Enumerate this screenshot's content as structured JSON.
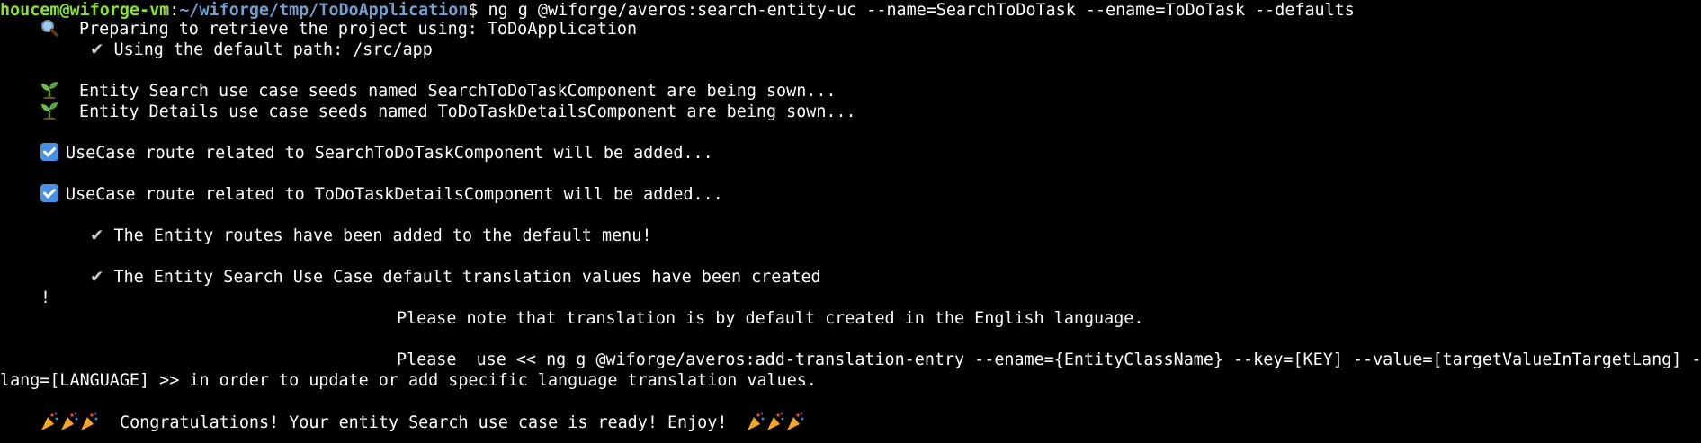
{
  "terminal": {
    "prompt": {
      "user_host": "houcem@wiforge-vm",
      "separator": ":",
      "path": "~/wiforge/tmp/ToDoApplication",
      "symbol": "$",
      "command": " ng g @wiforge/averos:search-entity-uc --name=SearchToDoTask --ename=ToDoTask --defaults"
    },
    "icons": {
      "search": "magnifying-glass-icon",
      "seedling": "seedling-icon",
      "check_box": "check-box-icon",
      "check_mark": "check-mark-icon",
      "party": "party-popper-icon"
    },
    "lines": {
      "preparing": "Preparing to retrieve the project using: ToDoApplication",
      "default_path": "Using the default path: /src/app",
      "search_seeds": "Entity Search use case seeds named SearchToDoTaskComponent are being sown...",
      "details_seeds": "Entity Details use case seeds named ToDoTaskDetailsComponent are being sown...",
      "route_search": "UseCase route related to SearchToDoTaskComponent will be added...",
      "route_details": "UseCase route related to ToDoTaskDetailsComponent will be added...",
      "menu_added": "The Entity routes have been added to the default menu!",
      "translation_created": "The Entity Search Use Case default translation values have been created",
      "exclamation": "!",
      "note_translation": "Please note that translation is by default created in the English language.",
      "please_use_1": "Please  use << ng g @wiforge/averos:add-translation-entry --ename={EntityClassName} --key=[KEY] --value=[targetValueInTargetLang] --",
      "please_use_2": "lang=[LANGUAGE] >> in order to update or add specific language translation values.",
      "congrats": "Congratulations! Your entity Search use case is ready! Enjoy!"
    },
    "colors": {
      "background": "#000000",
      "text": "#ffffff",
      "user_host": "#8ae234",
      "path": "#729fcf",
      "check_box": "#4a90e2"
    }
  }
}
